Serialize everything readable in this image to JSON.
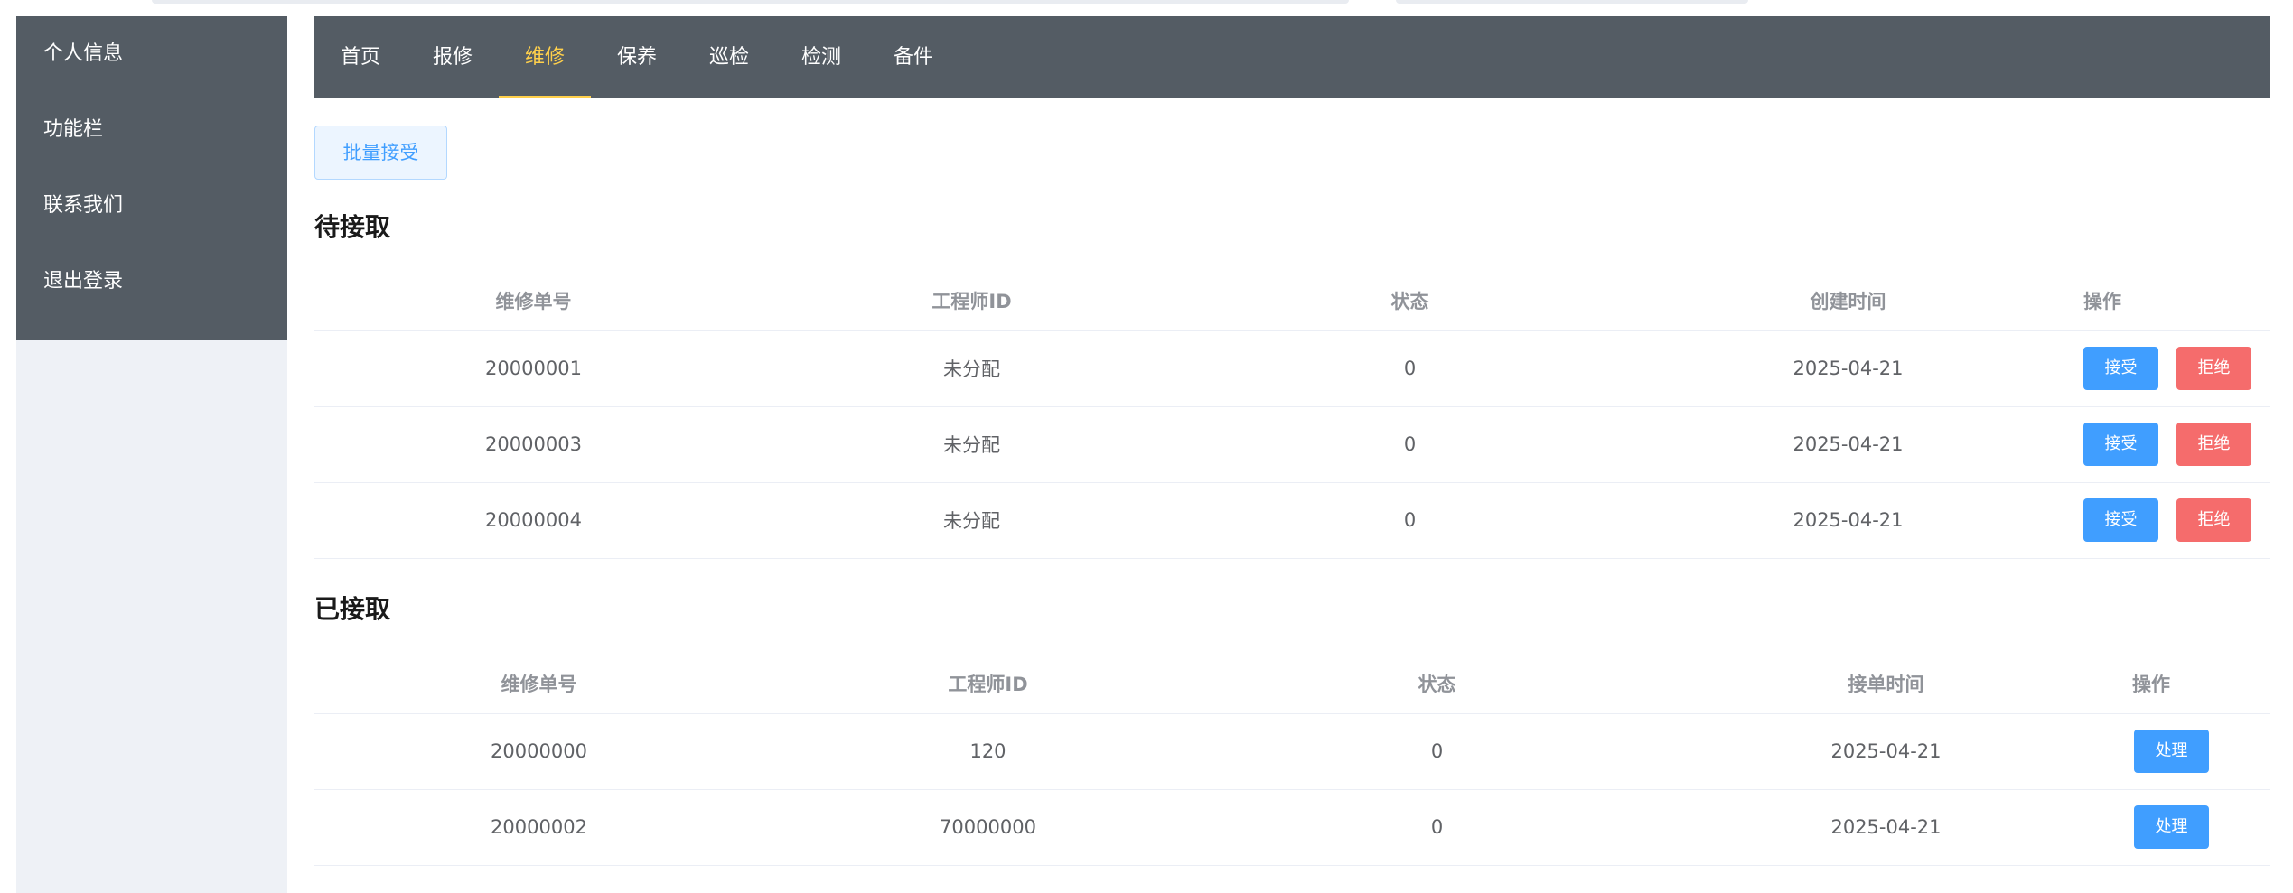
{
  "sidebar": {
    "items": [
      {
        "label": "个人信息"
      },
      {
        "label": "功能栏"
      },
      {
        "label": "联系我们"
      },
      {
        "label": "退出登录"
      }
    ]
  },
  "nav": {
    "items": [
      {
        "label": "首页"
      },
      {
        "label": "报修"
      },
      {
        "label": "维修",
        "active": true
      },
      {
        "label": "保养"
      },
      {
        "label": "巡检"
      },
      {
        "label": "检测"
      },
      {
        "label": "备件"
      }
    ],
    "active_color": "#ffd04b",
    "bg_color": "#545c64"
  },
  "batch_accept_label": "批量接受",
  "pending": {
    "title": "待接取",
    "columns": [
      "维修单号",
      "工程师ID",
      "状态",
      "创建时间",
      "操作"
    ],
    "rows": [
      {
        "id": "20000001",
        "engineer": "未分配",
        "status": "0",
        "time": "2025-04-21"
      },
      {
        "id": "20000003",
        "engineer": "未分配",
        "status": "0",
        "time": "2025-04-21"
      },
      {
        "id": "20000004",
        "engineer": "未分配",
        "status": "0",
        "time": "2025-04-21"
      }
    ],
    "accept_label": "接受",
    "reject_label": "拒绝"
  },
  "accepted": {
    "title": "已接取",
    "columns": [
      "维修单号",
      "工程师ID",
      "状态",
      "接单时间",
      "操作"
    ],
    "rows": [
      {
        "id": "20000000",
        "engineer": "120",
        "status": "0",
        "time": "2025-04-21"
      },
      {
        "id": "20000002",
        "engineer": "70000000",
        "status": "0",
        "time": "2025-04-21"
      }
    ],
    "handle_label": "处理"
  },
  "colors": {
    "primary": "#409eff",
    "danger": "#f56c6c",
    "sidebar_bg": "#545c64",
    "aside_bg": "#eef1f6"
  }
}
